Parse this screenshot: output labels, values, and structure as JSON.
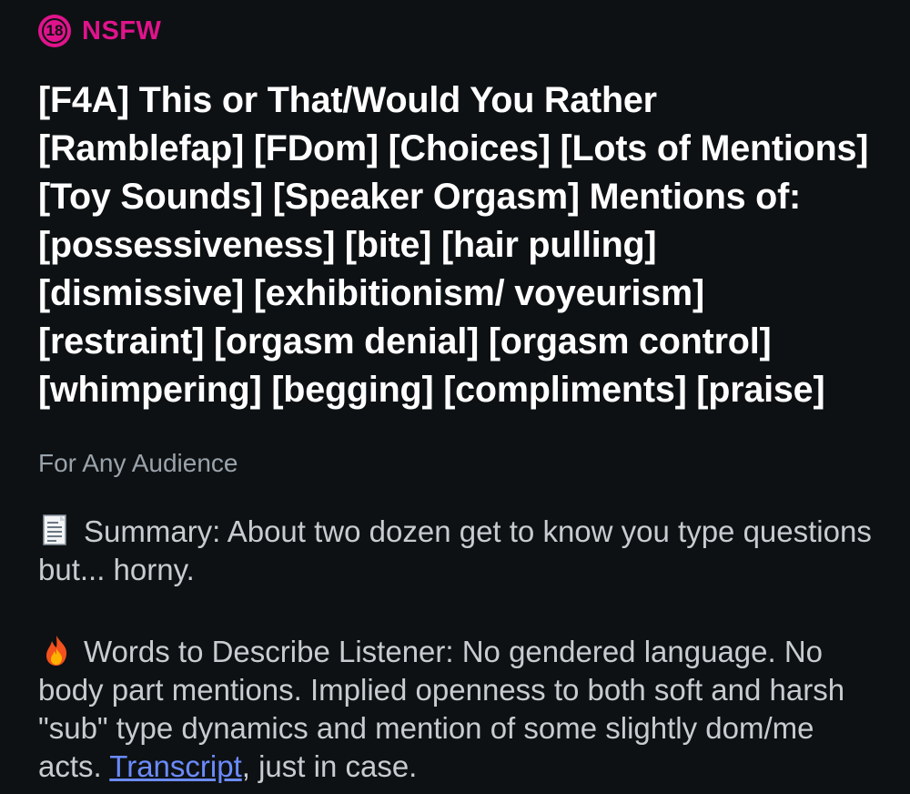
{
  "badge": {
    "number": "18",
    "label": "NSFW",
    "color": "#e0138c"
  },
  "post": {
    "title": "[F4A] This or That/Would You Rather [Ramblefap] [FDom] [Choices] [Lots of Mentions] [Toy Sounds] [Speaker Orgasm] Mentions of: [possessiveness] [bite] [hair pulling] [dismissive] [exhibitionism/ voyeurism] [restraint] [orgasm denial] [orgasm control] [whimpering] [begging] [compliments] [praise]",
    "flair": "For Any Audience",
    "summary": {
      "icon": "page-facing-up-icon",
      "text": "Summary: About two dozen get to know you type questions but... horny."
    },
    "listener": {
      "icon": "fire-icon",
      "text": "Words to Describe Listener: No gendered language. No body part mentions. Implied openness to both soft and harsh \"sub\" type dynamics and mention of some slightly dom/me acts. ",
      "link_label": "Transcript",
      "after_link": ", just in case."
    }
  }
}
